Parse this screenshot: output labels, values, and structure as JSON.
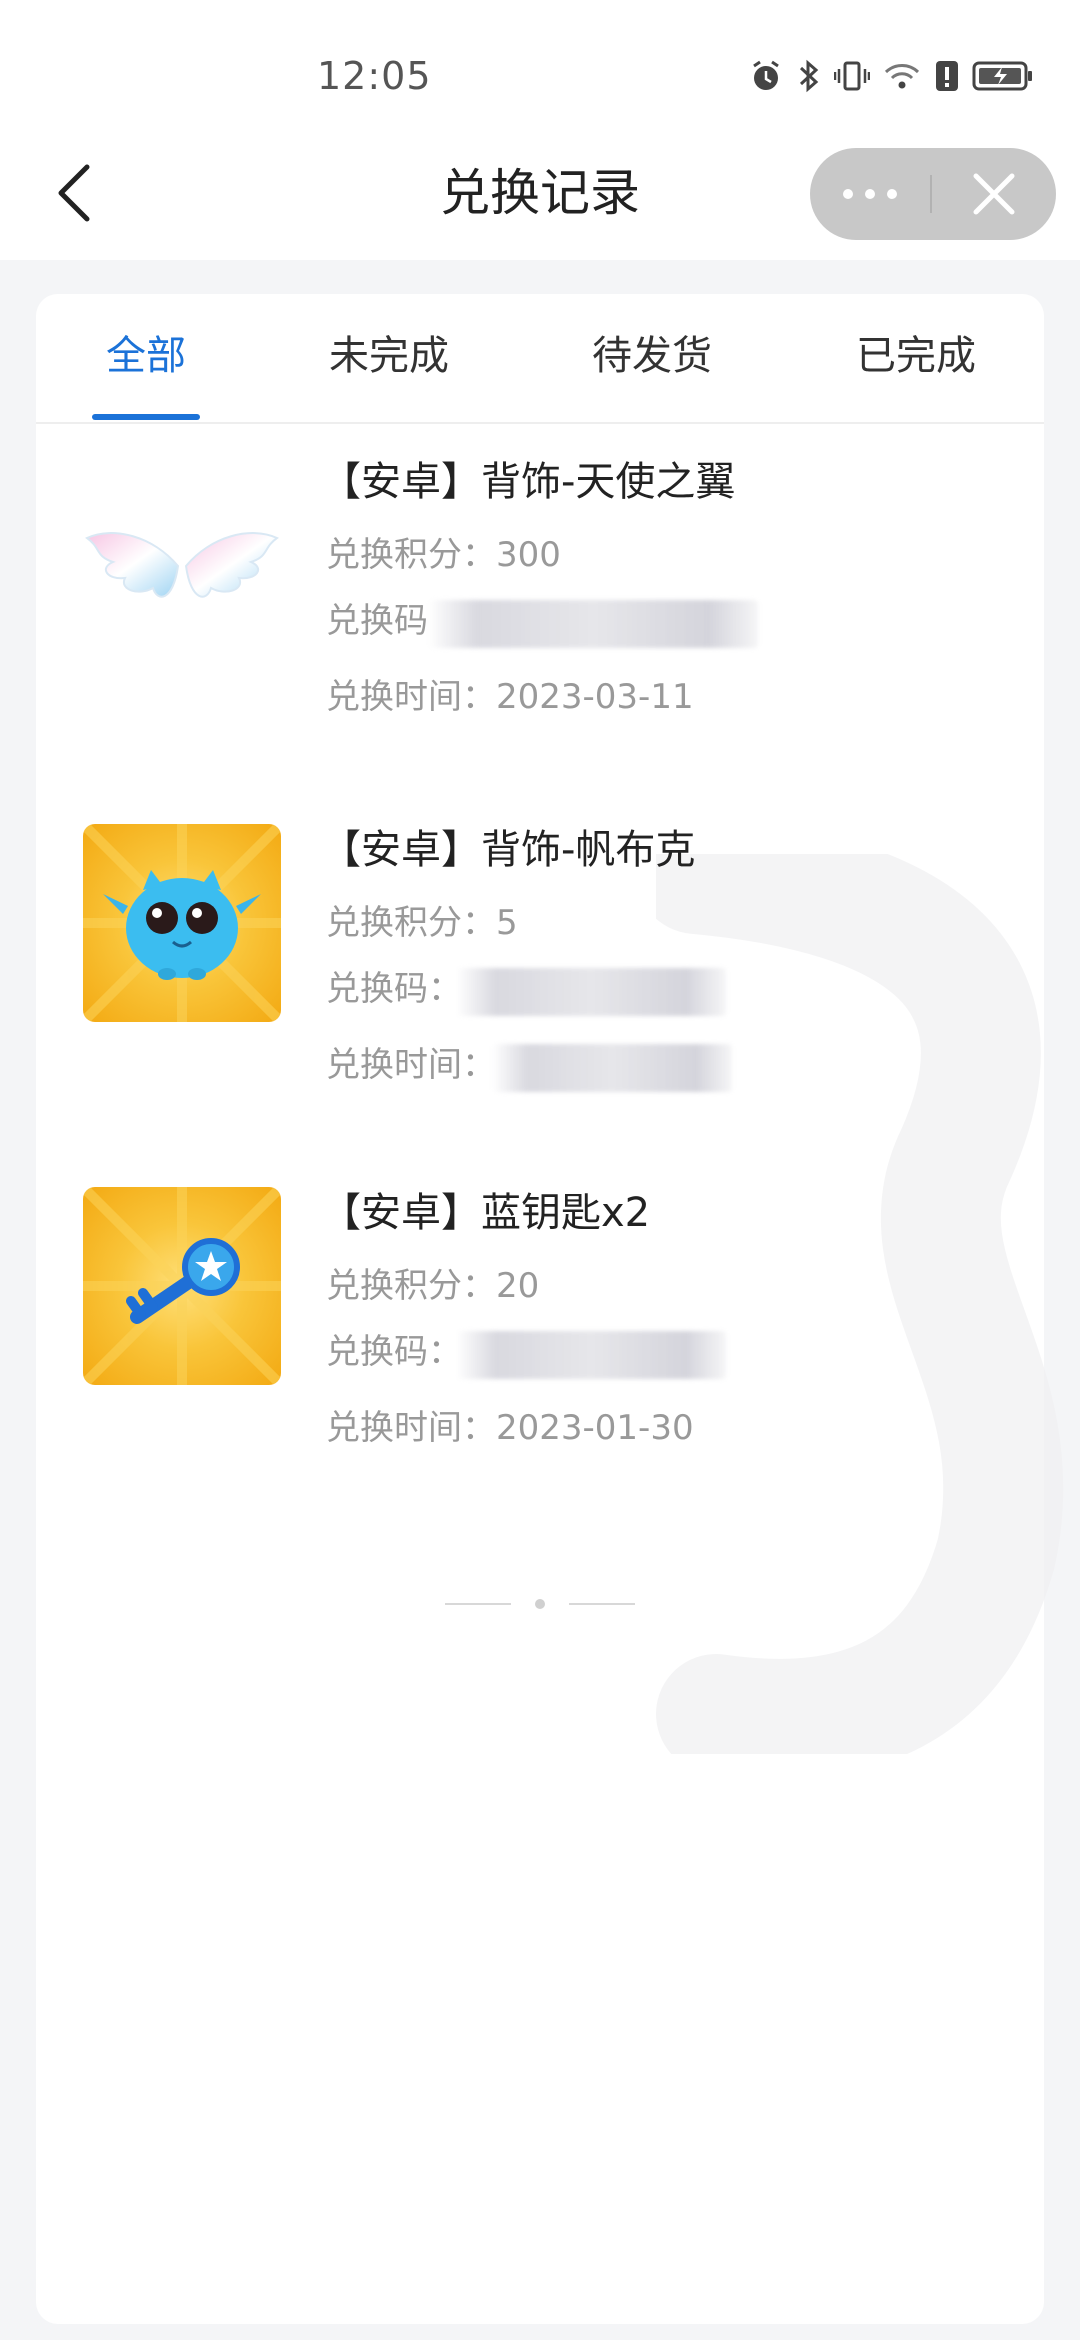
{
  "status_bar": {
    "time": "12:05",
    "icons": [
      "alarm-icon",
      "bluetooth-icon",
      "vibrate-icon",
      "wifi-icon",
      "sim-alert-icon",
      "battery-charging-icon"
    ]
  },
  "navbar": {
    "title": "兑换记录",
    "more_glyph": "···"
  },
  "tabs": [
    {
      "label": "全部",
      "active": true
    },
    {
      "label": "未完成",
      "active": false
    },
    {
      "label": "待发货",
      "active": false
    },
    {
      "label": "已完成",
      "active": false
    }
  ],
  "records": [
    {
      "title": "【安卓】背饰-天使之翼",
      "points_label": "兑换积分：",
      "points": "300",
      "code_label": "兑换码",
      "time_label": "兑换时间：",
      "time": "2023-03-11",
      "icon": "angel-wings-icon"
    },
    {
      "title": "【安卓】背饰-帆布克",
      "points_label": "兑换积分：",
      "points": "5",
      "code_label": "兑换码：",
      "time_label": "兑换时间：",
      "time": "",
      "icon": "blue-creature-icon"
    },
    {
      "title": "【安卓】蓝钥匙x2",
      "points_label": "兑换积分：",
      "points": "20",
      "code_label": "兑换码：",
      "time_label": "兑换时间：",
      "time": "2023-01-30",
      "icon": "blue-key-icon"
    }
  ],
  "colors": {
    "accent": "#1b72d8",
    "background": "#f4f5f7",
    "thumb_yellow": "#f7b21b"
  }
}
